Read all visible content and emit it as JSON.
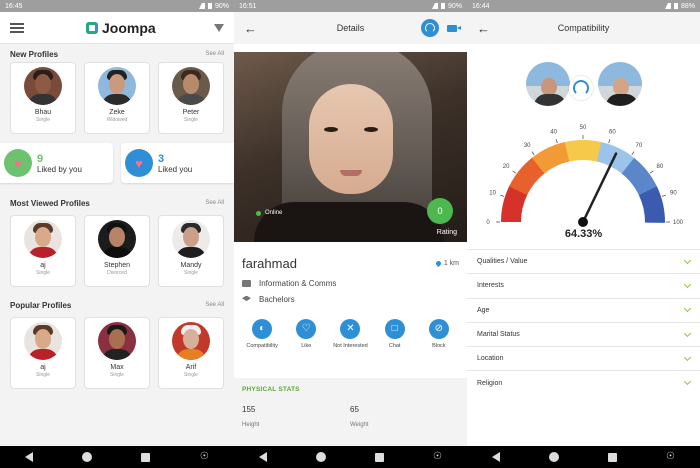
{
  "screen1": {
    "status": {
      "time": "16:45",
      "battery": "90%"
    },
    "app_name": "Joompa",
    "new_profiles": {
      "title": "New Profiles",
      "see_all": "See All",
      "items": [
        {
          "name": "Bhau",
          "status": "Single"
        },
        {
          "name": "Zeke",
          "status": "Widowed"
        },
        {
          "name": "Peter",
          "status": "Single"
        }
      ]
    },
    "liked_by_you": {
      "count": "9",
      "label": "Liked by you"
    },
    "liked_you": {
      "count": "3",
      "label": "Liked you"
    },
    "most_viewed": {
      "title": "Most Viewed Profiles",
      "see_all": "See All",
      "items": [
        {
          "name": "aj",
          "status": "Single"
        },
        {
          "name": "Stephen",
          "status": "Divorced"
        },
        {
          "name": "Mandy",
          "status": "Single"
        }
      ]
    },
    "popular": {
      "title": "Popular Profiles",
      "see_all": "See All",
      "items": [
        {
          "name": "aj",
          "status": "Single"
        },
        {
          "name": "Max",
          "status": "Single"
        },
        {
          "name": "Arif",
          "status": "Single"
        }
      ]
    },
    "colors": {
      "liked_green": "#6cc26f",
      "liked_blue": "#2f8fd6"
    }
  },
  "screen2": {
    "status": {
      "time": "16:51",
      "battery": "90%"
    },
    "title": "Details",
    "online_label": "Online",
    "rating_value": "0",
    "rating_label": "Rating",
    "username": "farahmad",
    "distance": "1 km",
    "occupation": "Information & Comms",
    "education": "Bachelors",
    "actions": [
      {
        "label": "Compatibility",
        "icon": "compatibility-icon"
      },
      {
        "label": "Like",
        "icon": "heart-icon"
      },
      {
        "label": "Not Interested",
        "icon": "close-icon"
      },
      {
        "label": "Chat",
        "icon": "chat-icon"
      },
      {
        "label": "Block",
        "icon": "block-icon"
      }
    ],
    "physical_stats": {
      "title": "PHYSICAL STATS",
      "height_value": "155",
      "height_label": "Height",
      "weight_value": "65",
      "weight_label": "Weight"
    }
  },
  "screen3": {
    "status": {
      "time": "16:44",
      "battery": "88%"
    },
    "title": "Compatibility",
    "gauge": {
      "ticks": [
        "0",
        "10",
        "20",
        "30",
        "40",
        "50",
        "60",
        "70",
        "80",
        "90",
        "100"
      ],
      "value": 64.33,
      "value_label": "64.33%",
      "colors": [
        "#d7322a",
        "#e8602c",
        "#f29a36",
        "#f6c94a",
        "#9cc4ea",
        "#5b86c9",
        "#3a5bb0"
      ]
    },
    "filters": [
      "Qualities / Value",
      "Interests",
      "Age",
      "Marital Status",
      "Location",
      "Religion"
    ]
  }
}
